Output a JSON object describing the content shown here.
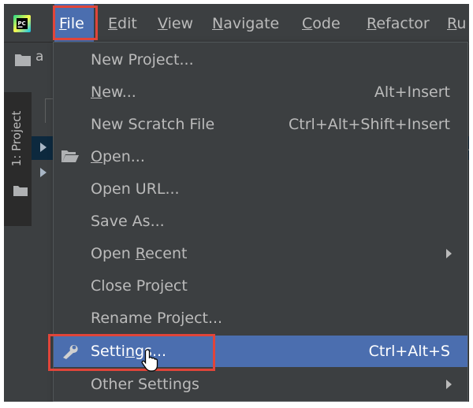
{
  "menubar": {
    "items": [
      {
        "before": "",
        "mn": "F",
        "after": "ile"
      },
      {
        "before": "",
        "mn": "E",
        "after": "dit"
      },
      {
        "before": "",
        "mn": "V",
        "after": "iew"
      },
      {
        "before": "",
        "mn": "N",
        "after": "avigate"
      },
      {
        "before": "",
        "mn": "C",
        "after": "ode"
      },
      {
        "before": "",
        "mn": "R",
        "after": "efactor"
      },
      {
        "before": "",
        "mn": "R",
        "after": "u"
      }
    ]
  },
  "navbar": {
    "text": "a"
  },
  "sidebar": {
    "tab_label": "1: Project"
  },
  "file_menu": {
    "items": [
      {
        "before": "New Project...",
        "mn": "",
        "after": "",
        "shortcut": ""
      },
      {
        "before": "",
        "mn": "N",
        "after": "ew...",
        "shortcut": "Alt+Insert"
      },
      {
        "before": "New Scratch File",
        "mn": "",
        "after": "",
        "shortcut": "Ctrl+Alt+Shift+Insert"
      },
      {
        "before": "",
        "mn": "O",
        "after": "pen...",
        "shortcut": ""
      },
      {
        "before": "Open URL...",
        "mn": "",
        "after": "",
        "shortcut": ""
      },
      {
        "before": "Save As...",
        "mn": "",
        "after": "",
        "shortcut": ""
      },
      {
        "before": "Open ",
        "mn": "R",
        "after": "ecent",
        "shortcut": ""
      },
      {
        "before": "Close Project",
        "mn": "",
        "after": "",
        "shortcut": ""
      },
      {
        "before": "Rename Project...",
        "mn": "",
        "after": "",
        "shortcut": ""
      },
      {
        "before": "Setti",
        "mn": "n",
        "after": "gs...",
        "shortcut": "Ctrl+Alt+S"
      },
      {
        "before": "Other Settings",
        "mn": "",
        "after": "",
        "shortcut": ""
      }
    ]
  },
  "colors": {
    "menu_bg": "#3c3f41",
    "selection": "#4b6eaf",
    "highlight_box": "#e0453a",
    "text": "#bbbbbb"
  }
}
